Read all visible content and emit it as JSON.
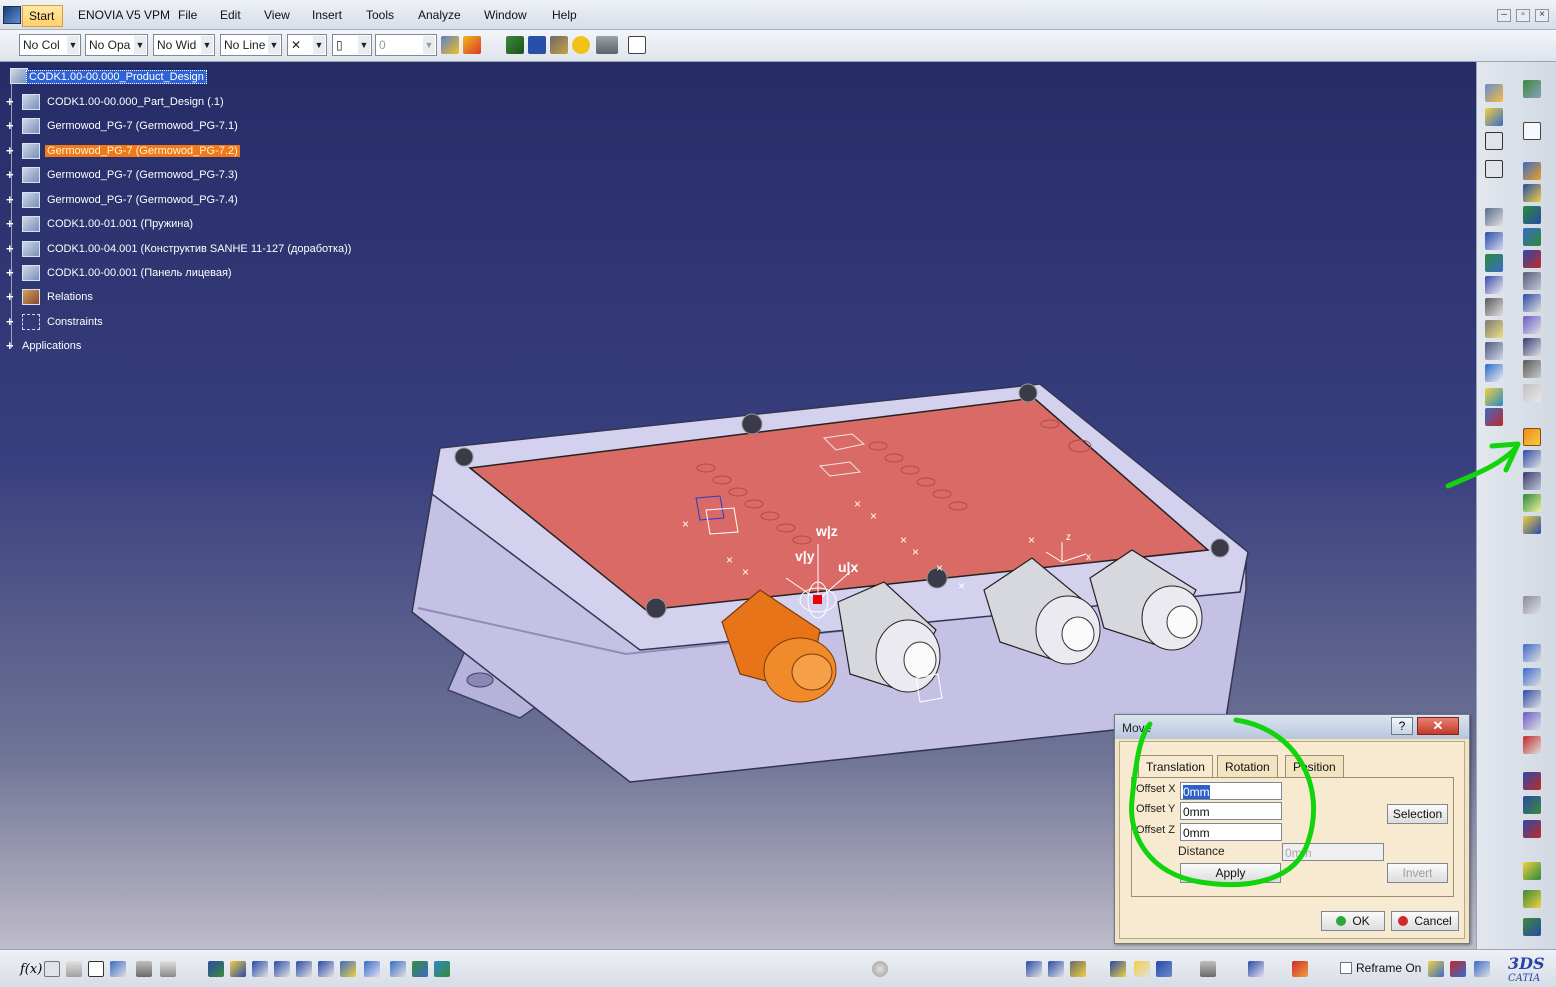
{
  "menu": {
    "start": "Start",
    "items": [
      "ENOVIA V5 VPM",
      "File",
      "Edit",
      "View",
      "Insert",
      "Tools",
      "Analyze",
      "Window",
      "Help"
    ]
  },
  "toolbar": {
    "color_combo": "No Col",
    "opacity_combo": "No Opa",
    "width_combo": "No Wid",
    "linetype_combo": "No Line",
    "layer_value": "0"
  },
  "tree": {
    "root": "CODK1.00-00.000_Product_Design",
    "items": [
      "CODK1.00-00.000_Part_Design (.1)",
      "Germowod_PG-7 (Germowod_PG-7.1)",
      "Germowod_PG-7 (Germowod_PG-7.2)",
      "Germowod_PG-7 (Germowod_PG-7.3)",
      "Germowod_PG-7 (Germowod_PG-7.4)",
      "CODK1.00-01.001 (Пружина)",
      "CODK1.00-04.001 (Конструктив SANHE 11-127 (доработка))",
      "CODK1.00-00.001 (Панель лицевая)",
      "Relations",
      "Constraints"
    ],
    "applications": "Applications"
  },
  "compass": {
    "wz": "w|z",
    "vy": "v|y",
    "ux": "u|x"
  },
  "dialog": {
    "title": "Move",
    "help": "?",
    "close": "✕",
    "tabs": [
      "Translation",
      "Rotation",
      "Position"
    ],
    "offset_x_label": "Offset X",
    "offset_y_label": "Offset Y",
    "offset_z_label": "Offset Z",
    "offset_x": "0mm",
    "offset_y": "0mm",
    "offset_z": "0mm",
    "distance_label": "Distance",
    "distance_value": "0mm",
    "selection": "Selection",
    "apply": "Apply",
    "invert": "Invert",
    "ok": "OK",
    "cancel": "Cancel"
  },
  "bottom": {
    "fx": "f(x)",
    "reframe": "Reframe On"
  },
  "logo": "CATIA",
  "colors": {
    "highlight_orange": "#f07a1a",
    "selection_blue": "#2f63d5",
    "annotation_green": "#12d40c",
    "lid_red": "#d96a66",
    "body_lavender": "#c9c6e8"
  }
}
